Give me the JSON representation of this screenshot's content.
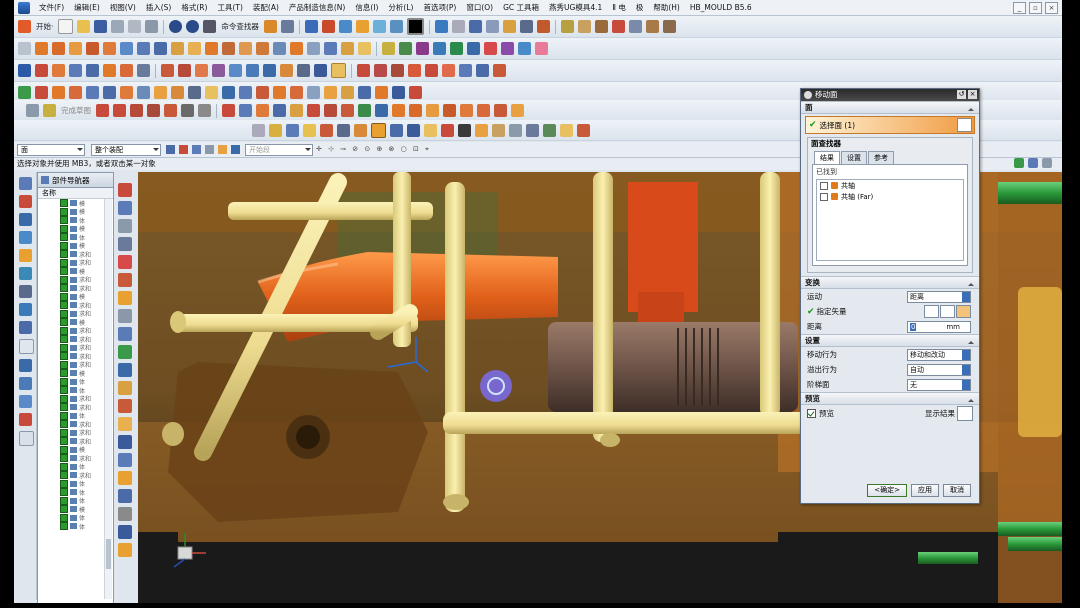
{
  "menu": [
    "文件(F)",
    "编辑(E)",
    "视图(V)",
    "插入(S)",
    "格式(R)",
    "工具(T)",
    "装配(A)",
    "产品制造信息(N)",
    "信息(I)",
    "分析(L)",
    "首选项(P)",
    "窗口(O)",
    "GC 工具箱",
    "燕秀UG模具4.1",
    "Ⅱ 电",
    "极",
    "帮助(H)",
    "HB_MOULD B5.6"
  ],
  "toolbar": {
    "start_label": "开始·",
    "cmd_finder_label": "命令查找器",
    "finish_sketch_label": "完成草图"
  },
  "selection_bar": {
    "filter": "面",
    "assembly_scope": "整个装配",
    "snap": "开始段"
  },
  "status_prompt": "选择对象并使用 MB3，或者双击某一对象",
  "nav": {
    "title": "部件导航器",
    "column": "名称",
    "rows": [
      "模",
      "模",
      "体",
      "模",
      "体",
      "模",
      "求和",
      "求和",
      "模",
      "求和",
      "求和",
      "模",
      "求和",
      "求和",
      "模",
      "求和",
      "求和",
      "求和",
      "求和",
      "求和",
      "模",
      "体",
      "体",
      "求和",
      "求和",
      "体",
      "求和",
      "求和",
      "求和",
      "模",
      "求和",
      "体",
      "求和",
      "体",
      "体",
      "体",
      "模",
      "体",
      "体"
    ]
  },
  "dialog": {
    "title": "移动面",
    "face_section": "面",
    "select_face": "选择面 (1)",
    "finder_section": "面查找器",
    "tabs": [
      "结果",
      "设置",
      "参考"
    ],
    "found_label": "已找到",
    "found_items": [
      "共轴",
      "共轴 (Far)"
    ],
    "transform_section": "变换",
    "motion_label": "运动",
    "motion_value": "距离",
    "vector_label": "指定矢量",
    "distance_label": "距离",
    "distance_value": "0",
    "distance_unit": "mm",
    "settings_section": "设置",
    "move_behavior_label": "移动行为",
    "move_behavior_value": "移动和改动",
    "overflow_label": "溢出行为",
    "overflow_value": "自动",
    "step_face_label": "阶梯面",
    "step_face_value": "无",
    "preview_section": "预览",
    "preview_label": "预览",
    "show_result_label": "显示结果",
    "ok": "<确定>",
    "apply": "应用",
    "cancel": "取消"
  },
  "colors": {
    "accent": "#f09a40",
    "mold_orange": "#e06a1a",
    "frame_yellow": "#f4e39a",
    "background_brown": "#6a4a20"
  }
}
